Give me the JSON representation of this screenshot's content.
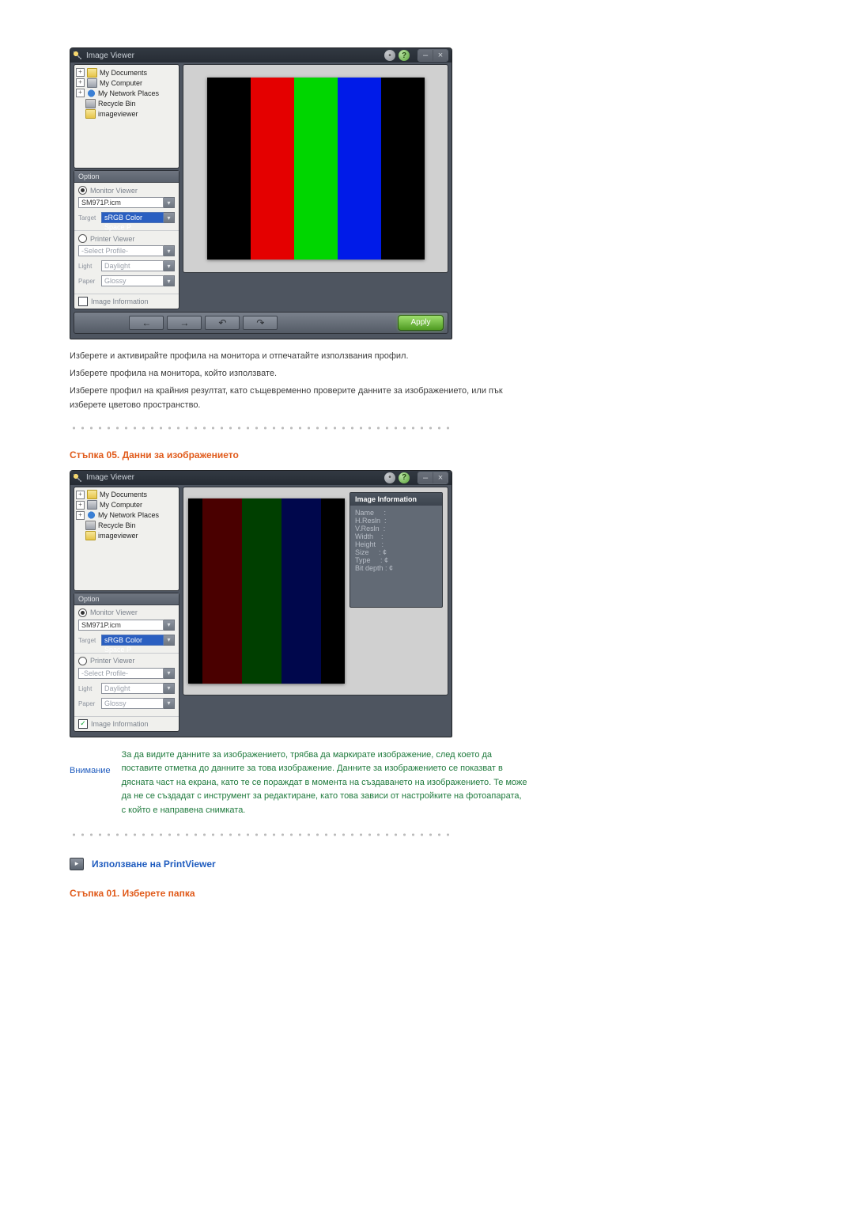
{
  "app": {
    "title": "Image Viewer",
    "apply": "Apply"
  },
  "tree": {
    "items": [
      {
        "label": "My Documents",
        "icon": "folder",
        "expandable": true
      },
      {
        "label": "My Computer",
        "icon": "computer",
        "expandable": true
      },
      {
        "label": "My Network Places",
        "icon": "network",
        "expandable": true
      },
      {
        "label": "Recycle Bin",
        "icon": "recycle",
        "expandable": false
      },
      {
        "label": "imageviewer",
        "icon": "folder",
        "expandable": false
      }
    ]
  },
  "option": {
    "header": "Option",
    "monitor_viewer": "Monitor Viewer",
    "monitor_profile": "SM971P.icm",
    "target_label": "Target",
    "target_value": "sRGB Color Space P",
    "printer_viewer": "Printer Viewer",
    "printer_profile": "-Select Profile-",
    "light_label": "Light",
    "light_value": "Daylight",
    "paper_label": "Paper",
    "paper_value": "Glossy",
    "img_info": "Image Information"
  },
  "image_info": {
    "title": "Image Information",
    "rows": [
      "Name     :",
      "H.Resln  :",
      "V.Resln  :",
      "Width    :",
      "Height   :",
      "Size     : ¢",
      "Type     : ¢",
      "Bit depth : ¢"
    ]
  },
  "text": {
    "para1a": "Изберете и активирайте профила на монитора и отпечатайте използвания профил.",
    "para1b": "Изберете профила на монитора, който използвате.",
    "para1c": "Изберете профил на крайния резултат, като същевременно проверите данните за изображението, или пък изберете цветово пространство.",
    "step05": "Стъпка 05. Данни за изображението",
    "attention_label": "Внимание",
    "attention_body": "За да видите данните за изображението, трябва да маркирате изображение, след което да поставите отметка до данните за това изображение. Данните за изображението се показват в дясната част на екрана, като те се пораждат в момента на създаването на изображението. Те може да не се създадат с инструмент за редактиране, като това зависи от настройките на фотоапарата, с който е направена снимката.",
    "section2": "Използване на PrintViewer",
    "step01": "Стъпка 01. Изберете папка"
  }
}
